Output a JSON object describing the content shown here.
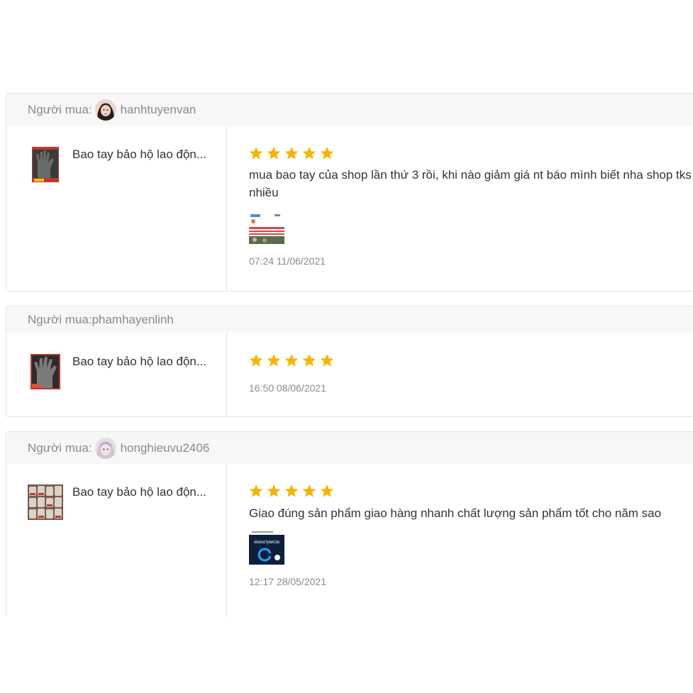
{
  "reviews": [
    {
      "buyer_label": "Người mua:",
      "buyer_name": "hanhtuyenvan",
      "has_avatar": true,
      "product_name": "Bao tay bảo hộ lao độn...",
      "rating": 5,
      "comment": "mua bao tay của shop lần thứ 3 rồi, khi nào giảm giá nt báo mình biết nha shop tks nhiều",
      "has_photo": true,
      "timestamp": "07:24 11/06/2021"
    },
    {
      "buyer_label": "Người mua:",
      "buyer_name": "phamhayenlinh",
      "has_avatar": false,
      "product_name": "Bao tay bảo hộ lao độn...",
      "rating": 5,
      "comment": "",
      "has_photo": false,
      "timestamp": "16:50 08/06/2021"
    },
    {
      "buyer_label": "Người mua:",
      "buyer_name": "honghieuvu2406",
      "has_avatar": true,
      "product_name": "Bao tay bảo hộ lao độn...",
      "rating": 5,
      "comment": "Giao đúng sản phẩm giao hàng nhanh chất lượng sản phẩm tốt cho năm sao",
      "has_photo": true,
      "photo_caption": "Advanced SystemCare",
      "timestamp": "12:17 28/05/2021"
    }
  ],
  "colors": {
    "star": "#f6b400",
    "header_bg": "#f7f7f7",
    "border": "#e6e6e6",
    "muted_text": "#8a8a8a",
    "body_text": "#333333"
  },
  "icons": {
    "star": "star-icon",
    "avatar": "avatar",
    "product": "product-thumbnail"
  }
}
